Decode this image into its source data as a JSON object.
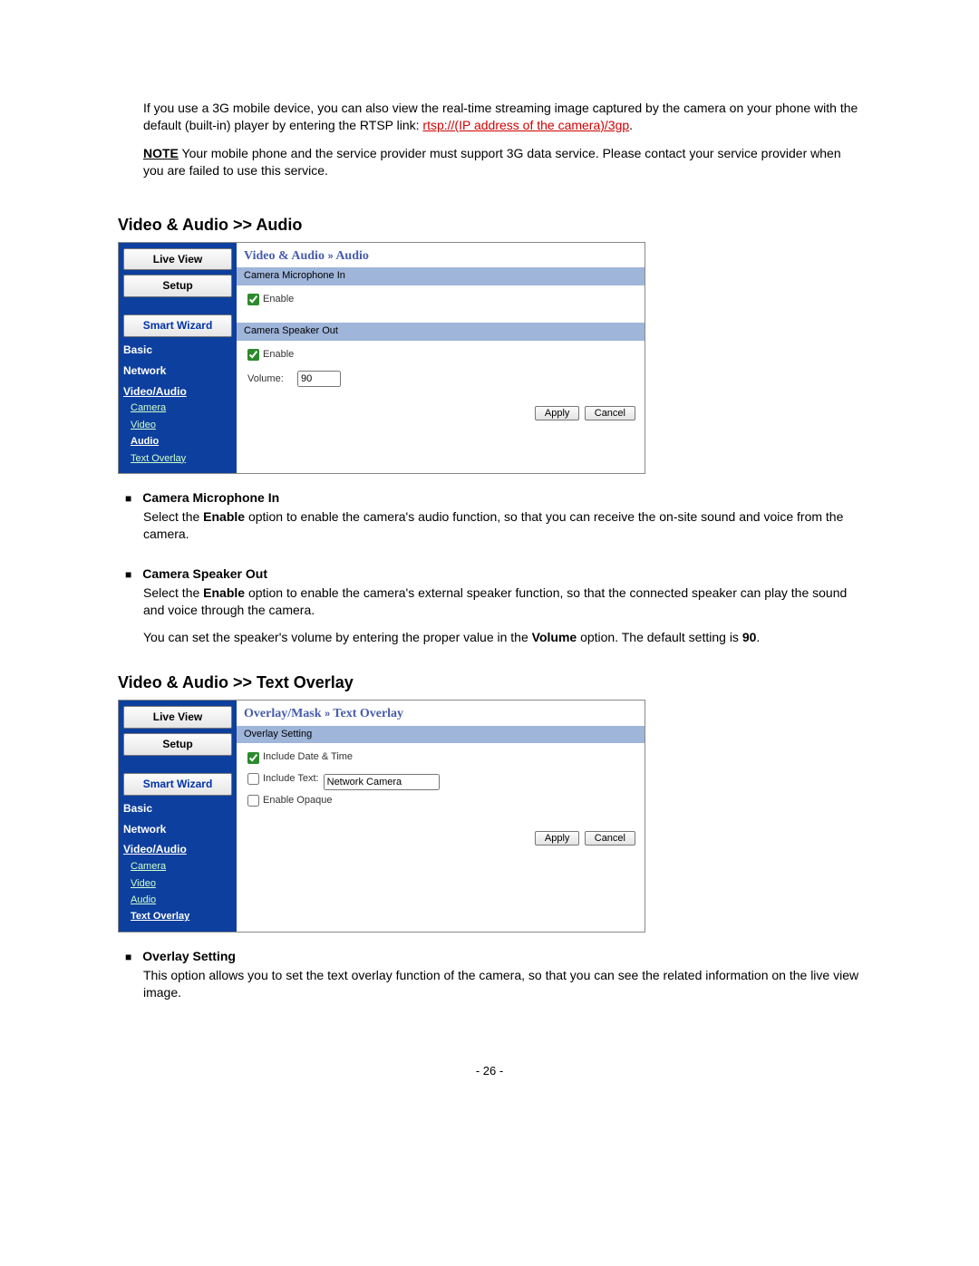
{
  "intro": {
    "paragraph": "If you use a 3G mobile device, you can also view the real-time streaming image captured by the camera on your phone with the default (built-in) player by entering the RTSP link: ",
    "link_text": "rtsp://(IP address of the camera)/3gp",
    "note_label": "NOTE",
    "note_text": "  Your mobile phone and the service provider must support 3G data service. Please contact your service provider when you are failed to use this service."
  },
  "section1": {
    "heading": "Video & Audio >> Audio",
    "breadcrumb_a": "Video & Audio",
    "breadcrumb_b": "Audio",
    "mic_head": "Camera Microphone In",
    "mic_enable": "Enable",
    "spk_head": "Camera Speaker Out",
    "spk_enable": "Enable",
    "volume_label": "Volume:",
    "volume_value": "90",
    "apply": "Apply",
    "cancel": "Cancel"
  },
  "section1_text": {
    "mic_h": "Camera Microphone In",
    "mic_p_a": "Select the ",
    "mic_p_bold": "Enable",
    "mic_p_b": " option to enable the camera's audio function, so that you can receive the on-site sound and voice from the camera.",
    "spk_h": "Camera Speaker Out",
    "spk_p_a": "Select the ",
    "spk_p_bold": "Enable",
    "spk_p_b": " option to enable the camera's external speaker function, so that the connected speaker can play the sound and voice through the camera.",
    "vol_a": "You can set the speaker's volume by entering the proper value in the ",
    "vol_bold": "Volume",
    "vol_b": " option. The default setting is ",
    "vol_bold2": "90",
    "vol_c": "."
  },
  "section2": {
    "heading": "Video & Audio >> Text Overlay",
    "breadcrumb_a": "Overlay/Mask",
    "breadcrumb_b": "Text Overlay",
    "overlay_head": "Overlay Setting",
    "chk_date": "Include Date & Time",
    "chk_text": "Include Text:",
    "text_value": "Network Camera",
    "chk_opaque": "Enable Opaque",
    "apply": "Apply",
    "cancel": "Cancel"
  },
  "section2_text": {
    "h": "Overlay Setting",
    "p": "This option allows you to set the text overlay function of the camera, so that you can see the related information on the live view image."
  },
  "sidebar": {
    "live_view": "Live View",
    "setup": "Setup",
    "smart_wizard": "Smart Wizard",
    "basic": "Basic",
    "network": "Network",
    "video_audio": "Video/Audio",
    "camera": "Camera",
    "video": "Video",
    "audio": "Audio",
    "text_overlay": "Text Overlay"
  },
  "page_num": "- 26 -"
}
